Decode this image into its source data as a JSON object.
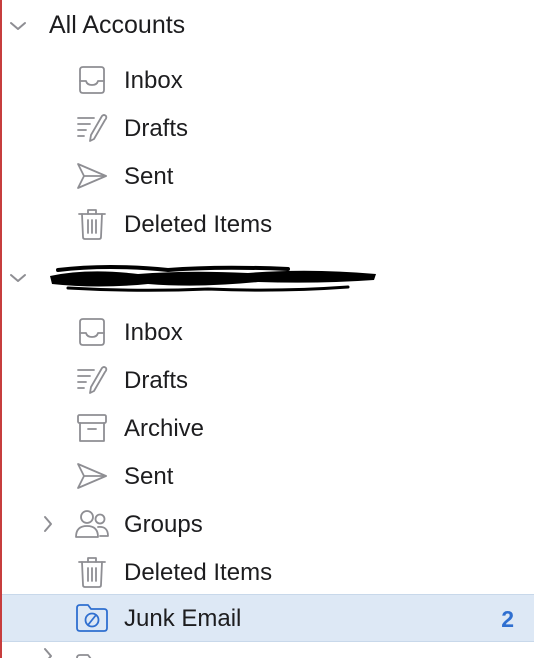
{
  "colors": {
    "accent": "#2f6fd0",
    "selection": "#dde8f5",
    "icon_gray": "#8e8e93",
    "left_edge": "#c73d3d"
  },
  "sections": [
    {
      "title": "All Accounts",
      "expanded": true,
      "items": [
        {
          "label": "Inbox",
          "icon": "inbox-icon"
        },
        {
          "label": "Drafts",
          "icon": "drafts-icon"
        },
        {
          "label": "Sent",
          "icon": "sent-icon"
        },
        {
          "label": "Deleted Items",
          "icon": "trash-icon"
        }
      ]
    },
    {
      "title": "",
      "title_redacted": true,
      "expanded": true,
      "items": [
        {
          "label": "Inbox",
          "icon": "inbox-icon"
        },
        {
          "label": "Drafts",
          "icon": "drafts-icon"
        },
        {
          "label": "Archive",
          "icon": "archive-icon"
        },
        {
          "label": "Sent",
          "icon": "sent-icon"
        },
        {
          "label": "Groups",
          "icon": "groups-icon",
          "collapsible": true
        },
        {
          "label": "Deleted Items",
          "icon": "trash-icon"
        },
        {
          "label": "Junk Email",
          "icon": "junk-icon",
          "count": "2",
          "selected": true
        }
      ]
    }
  ]
}
